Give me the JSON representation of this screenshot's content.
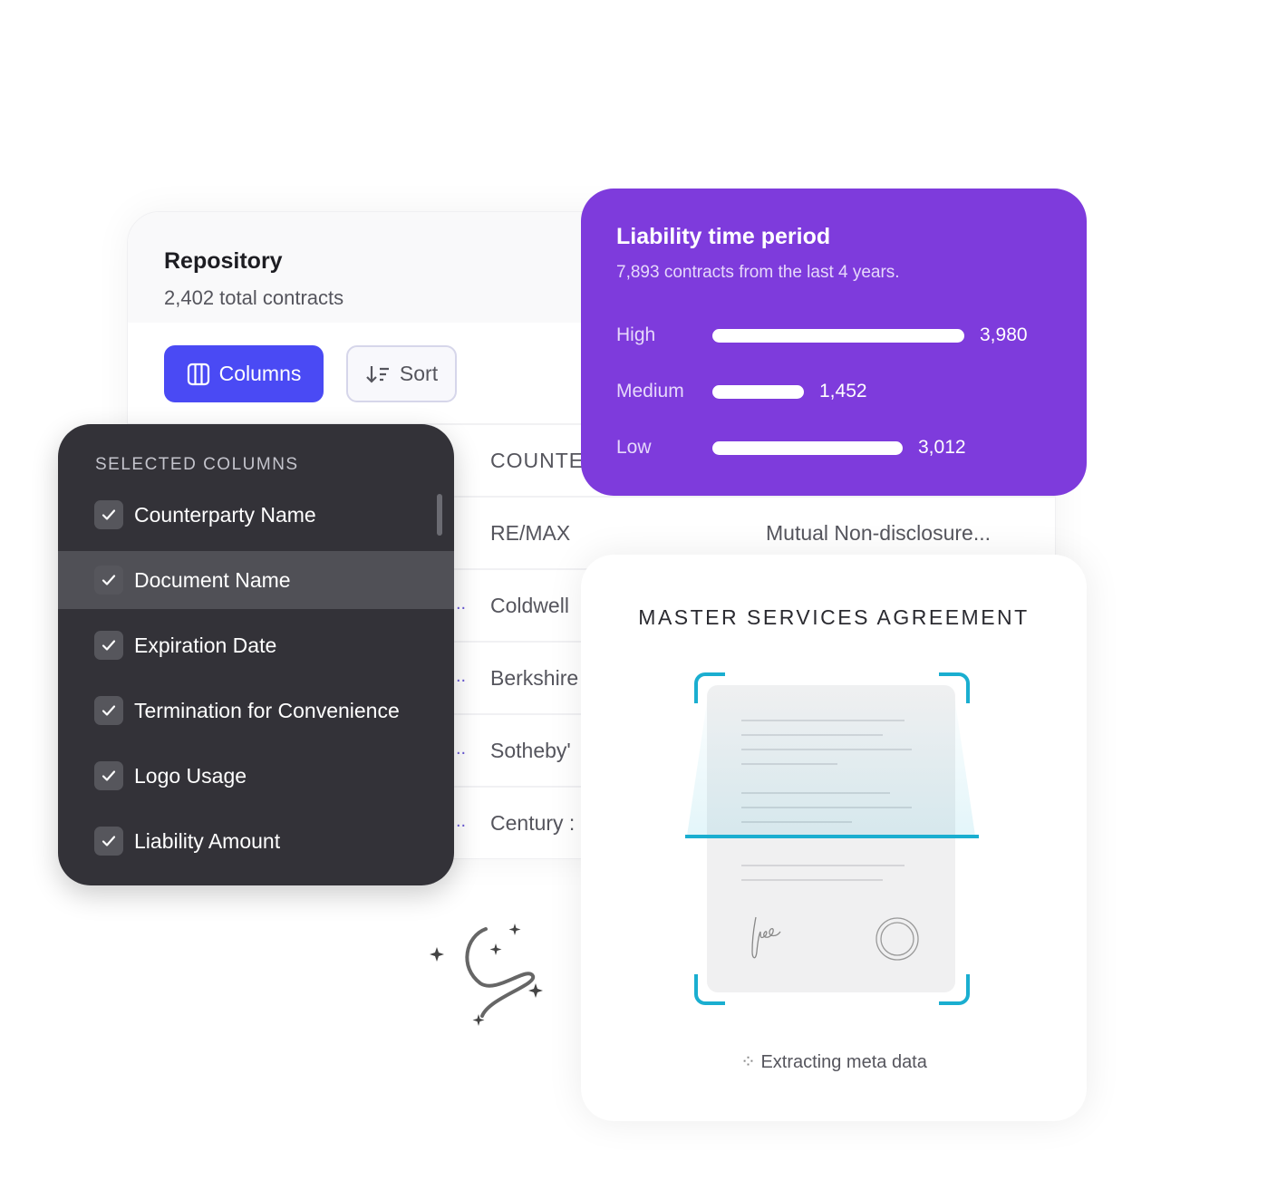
{
  "repository": {
    "title": "Repository",
    "subtitle": "2,402 total contracts",
    "columns_label": "Columns",
    "sort_label": "Sort",
    "table": {
      "header": "COUNTE",
      "rows": [
        {
          "prefix": "",
          "counterparty": "RE/MAX",
          "document": "Mutual Non-disclosure..."
        },
        {
          "prefix": "..",
          "counterparty": "Coldwell",
          "document": ""
        },
        {
          "prefix": "..",
          "counterparty": "Berkshire",
          "document": ""
        },
        {
          "prefix": "..",
          "counterparty": "Sotheby'",
          "document": ""
        },
        {
          "prefix": "..",
          "counterparty": "Century :",
          "document": ""
        }
      ]
    }
  },
  "selected_columns": {
    "heading": "SELECTED COLUMNS",
    "items": [
      {
        "label": "Counterparty Name",
        "checked": true
      },
      {
        "label": "Document Name",
        "checked": true,
        "highlighted": true
      },
      {
        "label": "Expiration Date",
        "checked": true
      },
      {
        "label": "Termination for Convenience",
        "checked": true
      },
      {
        "label": "Logo Usage",
        "checked": true
      },
      {
        "label": "Liability Amount",
        "checked": true
      }
    ]
  },
  "liability": {
    "title": "Liability time period",
    "subtitle": "7,893 contracts from the last 4 years.",
    "bars": [
      {
        "label": "High",
        "value": 3980,
        "display": "3,980"
      },
      {
        "label": "Medium",
        "value": 1452,
        "display": "1,452"
      },
      {
        "label": "Low",
        "value": 3012,
        "display": "3,012"
      }
    ]
  },
  "msa": {
    "title": "MASTER SERVICES AGREEMENT",
    "status": "Extracting meta data"
  },
  "colors": {
    "primary": "#4a4af4",
    "purple": "#7e3bdc",
    "dark": "#333238",
    "scan": "#1aaed0"
  }
}
